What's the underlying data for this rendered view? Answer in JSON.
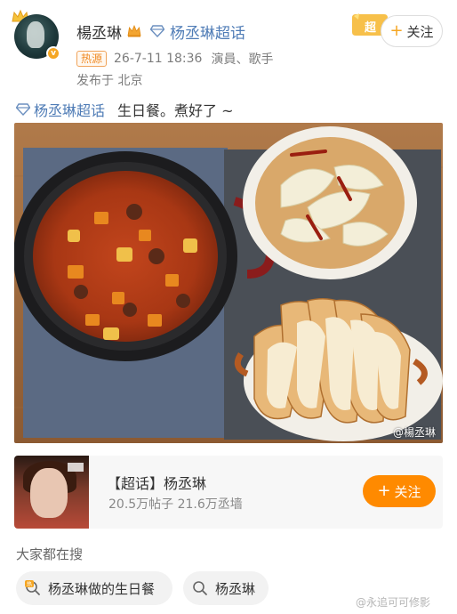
{
  "user": {
    "name": "楊丞琳",
    "supertopic_link": "杨丞琳超话",
    "hot_badge": "热源",
    "timestamp": "26-7-11 18:36",
    "tags": "演員、歌手",
    "location": "发布于 北京",
    "verified_badge": "v"
  },
  "header": {
    "super_badge": "超",
    "follow_label": "关注",
    "follow_plus": "+"
  },
  "post": {
    "topic": "杨丞琳超话",
    "text": "生日餐。煮好了 ~",
    "watermark": "@楊丞琳"
  },
  "card": {
    "title": "【超话】杨丞琳",
    "stats": "20.5万帖子 21.6万丞墙",
    "follow_label": "关注",
    "follow_plus": "+"
  },
  "search": {
    "heading": "大家都在搜",
    "chips": [
      {
        "label": "杨丞琳做的生日餐",
        "icon": "hot-search-icon"
      },
      {
        "label": "杨丞琳",
        "icon": "search-icon"
      }
    ],
    "bottom_watermark": "@永追可可修影"
  },
  "icons": {
    "crown": "crown-icon",
    "diamond": "diamond-icon",
    "verified": "verified-badge-icon"
  },
  "colors": {
    "accent_orange": "#ff8a00",
    "link_blue": "#4f7cb6",
    "badge_orange": "#f08a24"
  }
}
